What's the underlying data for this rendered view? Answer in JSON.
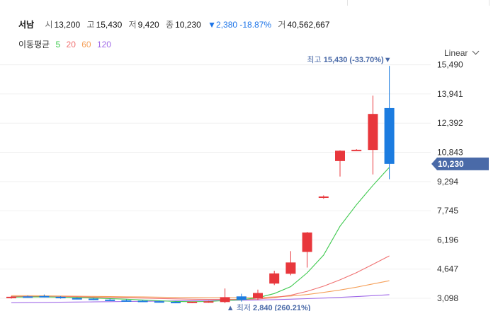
{
  "header": {
    "name": "서남",
    "open_label": "시",
    "open": "13,200",
    "high_label": "고",
    "high": "15,430",
    "low_label": "저",
    "low": "9,420",
    "close_label": "종",
    "close": "10,230",
    "change": "▼2,380 -18.87%",
    "volume_label": "거",
    "volume": "40,562,667"
  },
  "ma_legend": {
    "title": "이동평균",
    "periods": [
      "5",
      "20",
      "60",
      "120"
    ]
  },
  "scale_mode": "Linear",
  "colors": {
    "up": "#e8373c",
    "down": "#1c7ce0",
    "ma5": "#3ec94e",
    "ma20": "#f07070",
    "ma60": "#f5a05a",
    "ma120": "#a06ae8",
    "price_tag": "#4a6aa8"
  },
  "chart_data": {
    "type": "candlestick",
    "y_ticks": [
      "15,490",
      "13,941",
      "12,392",
      "10,843",
      "9,294",
      "7,745",
      "6,196",
      "4,647",
      "3,098"
    ],
    "ylim": [
      2800,
      15850
    ],
    "grid": true,
    "candles": [
      {
        "o": 3150,
        "h": 3220,
        "l": 3080,
        "c": 3180
      },
      {
        "o": 3200,
        "h": 3250,
        "l": 3130,
        "c": 3160
      },
      {
        "o": 3220,
        "h": 3300,
        "l": 3150,
        "c": 3170
      },
      {
        "o": 3180,
        "h": 3210,
        "l": 3080,
        "c": 3100
      },
      {
        "o": 3110,
        "h": 3150,
        "l": 3040,
        "c": 3060
      },
      {
        "o": 3080,
        "h": 3120,
        "l": 3000,
        "c": 3020
      },
      {
        "o": 3030,
        "h": 3080,
        "l": 2960,
        "c": 2990
      },
      {
        "o": 2990,
        "h": 3040,
        "l": 2930,
        "c": 2960
      },
      {
        "o": 2970,
        "h": 3010,
        "l": 2900,
        "c": 2930
      },
      {
        "o": 2940,
        "h": 2980,
        "l": 2870,
        "c": 2900
      },
      {
        "o": 2910,
        "h": 2950,
        "l": 2850,
        "c": 2870
      },
      {
        "o": 2880,
        "h": 2930,
        "l": 2840,
        "c": 2920
      },
      {
        "o": 2910,
        "h": 2960,
        "l": 2860,
        "c": 2940
      },
      {
        "o": 2900,
        "h": 3620,
        "l": 2840,
        "c": 3160
      },
      {
        "o": 3200,
        "h": 3340,
        "l": 2920,
        "c": 3020
      },
      {
        "o": 3100,
        "h": 3560,
        "l": 3010,
        "c": 3380
      },
      {
        "o": 3880,
        "h": 4560,
        "l": 3800,
        "c": 4420
      },
      {
        "o": 4400,
        "h": 5600,
        "l": 4320,
        "c": 5000
      },
      {
        "o": 5560,
        "h": 6620,
        "l": 4730,
        "c": 6590
      },
      {
        "o": 8480,
        "h": 8560,
        "l": 8380,
        "c": 8500
      },
      {
        "o": 10380,
        "h": 10950,
        "l": 9560,
        "c": 10930
      },
      {
        "o": 10970,
        "h": 11010,
        "l": 10930,
        "c": 10980
      },
      {
        "o": 10970,
        "h": 13850,
        "l": 9670,
        "c": 12880
      },
      {
        "o": 13190,
        "h": 15430,
        "l": 9420,
        "c": 10230
      }
    ],
    "ma5": [
      3160,
      3170,
      3170,
      3160,
      3140,
      3110,
      3080,
      3050,
      3010,
      2970,
      2930,
      2920,
      2930,
      2980,
      3020,
      3130,
      3350,
      3720,
      4450,
      5390,
      6920,
      8060,
      9090,
      10050
    ],
    "ma20": [
      3190,
      3190,
      3190,
      3180,
      3170,
      3160,
      3140,
      3130,
      3110,
      3090,
      3070,
      3050,
      3040,
      3040,
      3040,
      3060,
      3130,
      3260,
      3470,
      3740,
      4080,
      4460,
      4900,
      5350
    ],
    "ma60": [
      3240,
      3240,
      3230,
      3220,
      3210,
      3200,
      3190,
      3180,
      3170,
      3160,
      3150,
      3140,
      3130,
      3130,
      3130,
      3140,
      3170,
      3220,
      3300,
      3410,
      3540,
      3690,
      3860,
      4030
    ],
    "ma120": [
      2860,
      2870,
      2880,
      2890,
      2900,
      2910,
      2920,
      2930,
      2940,
      2950,
      2960,
      2970,
      2980,
      2990,
      3000,
      3010,
      3030,
      3050,
      3080,
      3110,
      3150,
      3190,
      3240,
      3290
    ],
    "current_price": "10,230",
    "max_annotation": {
      "label": "최고",
      "value": "15,430 (-33.70%)",
      "marker": "▼"
    },
    "min_annotation": {
      "label": "최저",
      "value": "2,840 (260.21%)",
      "marker": "▲"
    }
  }
}
